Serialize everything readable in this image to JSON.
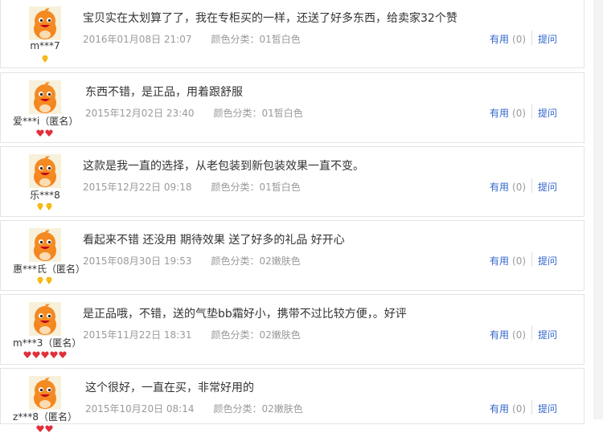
{
  "reviews": [
    {
      "user": "m***7",
      "content": "宝贝实在太划算了了，我在专柜买的一样，还送了好多东西，给卖家32个赞",
      "date": "2016年01月08日 21:07",
      "color": "颜色分类：01皙白色",
      "useful_label": "有用",
      "useful_count": "(0)",
      "ask_label": "提问",
      "badge": "gold",
      "badge_count": 1
    },
    {
      "user": "爱***i（匿名）",
      "content": "东西不错，是正品，用着跟舒服",
      "date": "2015年12月02日 23:40",
      "color": "颜色分类：01皙白色",
      "useful_label": "有用",
      "useful_count": "(0)",
      "ask_label": "提问",
      "badge": "red",
      "badge_count": 2
    },
    {
      "user": "乐***8",
      "content": "这款是我一直的选择，从老包装到新包装效果一直不变。",
      "date": "2015年12月22日 09:18",
      "color": "颜色分类：01皙白色",
      "useful_label": "有用",
      "useful_count": "(0)",
      "ask_label": "提问",
      "badge": "gold",
      "badge_count": 2
    },
    {
      "user": "惠***氏（匿名）",
      "content": "看起来不错 还没用 期待效果 送了好多的礼品 好开心",
      "date": "2015年08月30日 19:53",
      "color": "颜色分类：02嫩肤色",
      "useful_label": "有用",
      "useful_count": "(0)",
      "ask_label": "提问",
      "badge": "gold",
      "badge_count": 2
    },
    {
      "user": "m***3（匿名）",
      "content": "是正品哦，不错，送的气垫bb霜好小，携带不过比较方便，。好评",
      "date": "2015年11月22日 18:31",
      "color": "颜色分类：02嫩肤色",
      "useful_label": "有用",
      "useful_count": "(0)",
      "ask_label": "提问",
      "badge": "red",
      "badge_count": 5
    },
    {
      "user": "z***8（匿名）",
      "content": "这个很好，一直在买，非常好用的",
      "date": "2015年10月20日 08:14",
      "color": "颜色分类：02嫩肤色",
      "useful_label": "有用",
      "useful_count": "(0)",
      "ask_label": "提问",
      "badge": "red",
      "badge_count": 2
    }
  ],
  "colors": {
    "link": "#3366cc",
    "meta": "#9a9a9a",
    "gold": "#f5b400",
    "red": "#e0303a"
  }
}
